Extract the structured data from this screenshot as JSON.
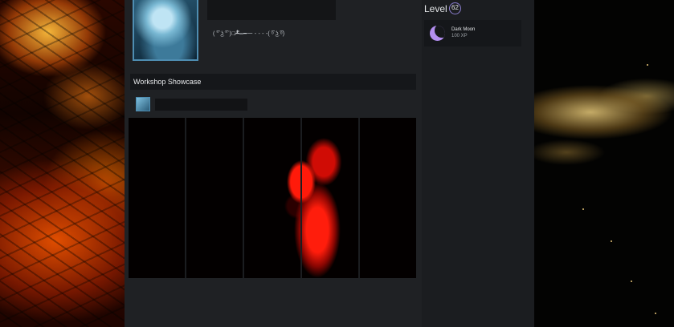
{
  "profile": {
    "status_text": "( ͡ᵔ ͜ʖ ͡ᵔ )︻̷┻̿═━一 - - - -( ͡ᵒ ͜ʖ ͡ᵒ)"
  },
  "showcase": {
    "header": "Workshop Showcase"
  },
  "level": {
    "label": "Level",
    "value": "62"
  },
  "badge": {
    "icon": "moon-icon",
    "name": "Dark Moon",
    "xp": "100 XP",
    "color": "#b38ef0"
  },
  "colors": {
    "panel": "#1f2124",
    "accent": "#4e8db1"
  }
}
